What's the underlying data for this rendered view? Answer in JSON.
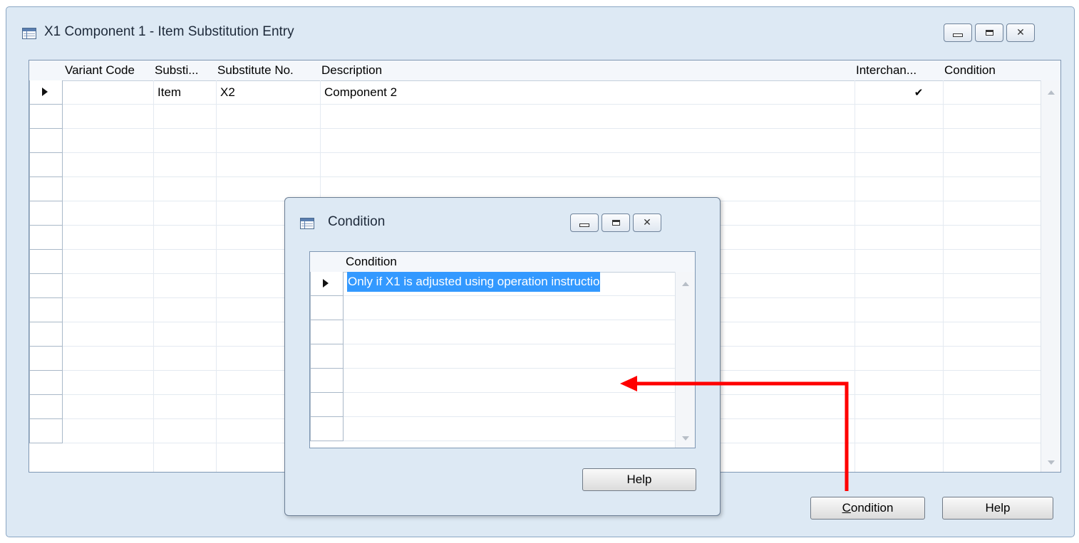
{
  "main_window": {
    "title": "X1 Component 1 - Item Substitution Entry",
    "columns": [
      "Variant Code",
      "Substi...",
      "Substitute No.",
      "Description",
      "Interchan...",
      "Condition"
    ],
    "rows": [
      {
        "variant_code": "",
        "type": "Item",
        "substitute_no": "X2",
        "description": "Component 2",
        "interchangeable": "✔",
        "condition": ""
      }
    ],
    "empty_row_count": 14,
    "buttons": {
      "condition_prefix": "C",
      "condition_rest": "ondition",
      "help": "Help"
    }
  },
  "dialog": {
    "title": "Condition",
    "column": "Condition",
    "rows": [
      "Only if X1 is adjusted using operation instructio"
    ],
    "empty_row_count": 6,
    "help_button": "Help"
  },
  "colors": {
    "window_bg": "#dde9f4",
    "selection": "#3399ff",
    "annotation_arrow": "#ff0000"
  },
  "icons": [
    "table-window-icon",
    "minimize-icon",
    "maximize-icon",
    "close-icon",
    "row-pointer-icon",
    "check-icon",
    "scroll-up-icon",
    "scroll-down-icon"
  ]
}
